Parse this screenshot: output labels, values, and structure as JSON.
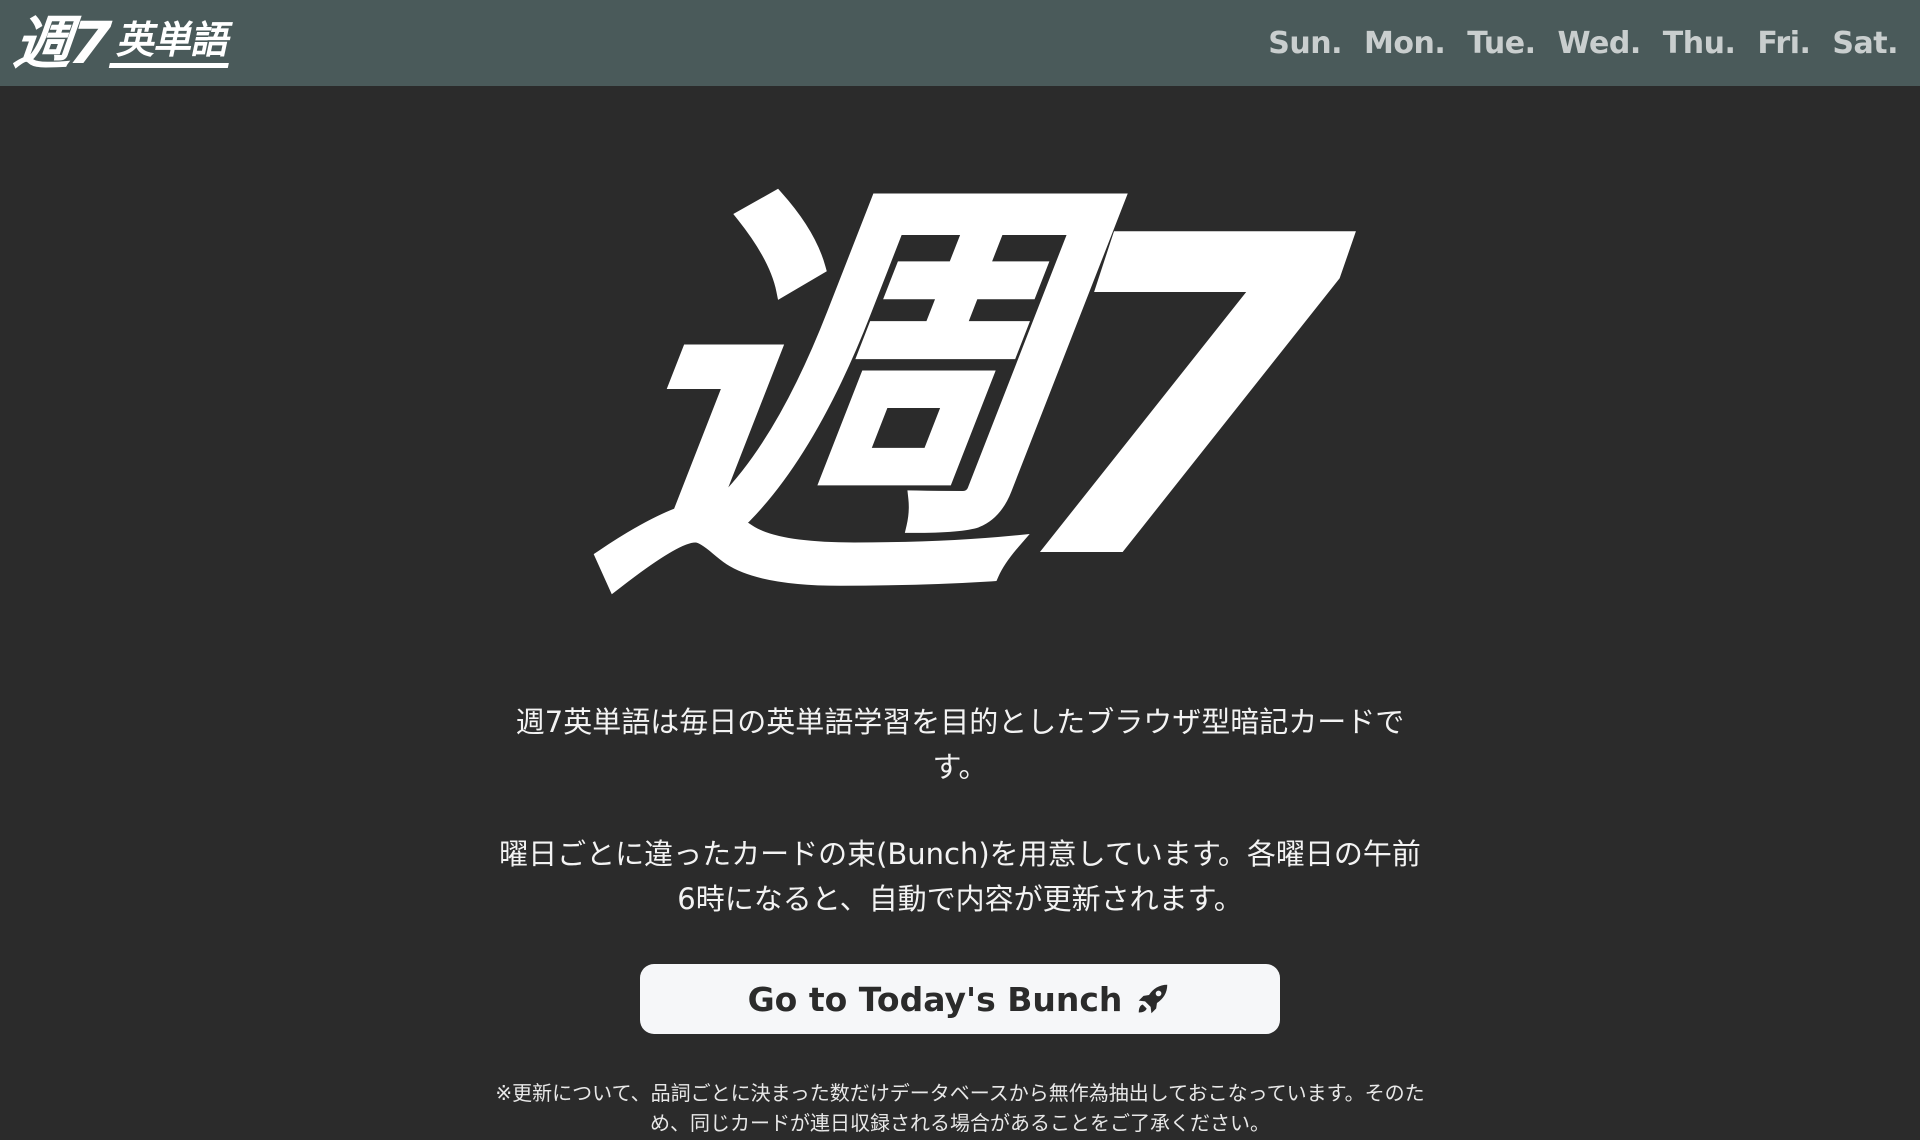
{
  "header": {
    "brand_main": "週7",
    "brand_sub": "英単語",
    "days": [
      "Sun.",
      "Mon.",
      "Tue.",
      "Wed.",
      "Thu.",
      "Fri.",
      "Sat."
    ]
  },
  "hero": {
    "logo_text": "週7"
  },
  "main": {
    "description_1": "週7英単語は毎日の英単語学習を目的としたブラウザ型暗記カードです。",
    "description_2": "曜日ごとに違ったカードの束(Bunch)を用意しています。各曜日の午前6時になると、自動で内容が更新されます。",
    "cta_label": "Go to Today's Bunch",
    "cta_icon": "rocket-icon",
    "note": "※更新について、品詞ごとに決まった数だけデータベースから無作為抽出しておこなっています。そのため、同じカードが連日収録される場合があることをご了承ください。"
  },
  "colors": {
    "background": "#2b2b2b",
    "topbar": "#4a5a5a",
    "day_text": "#c9cece",
    "button_bg": "#f6f7f9",
    "button_text": "#2b2b2b"
  }
}
